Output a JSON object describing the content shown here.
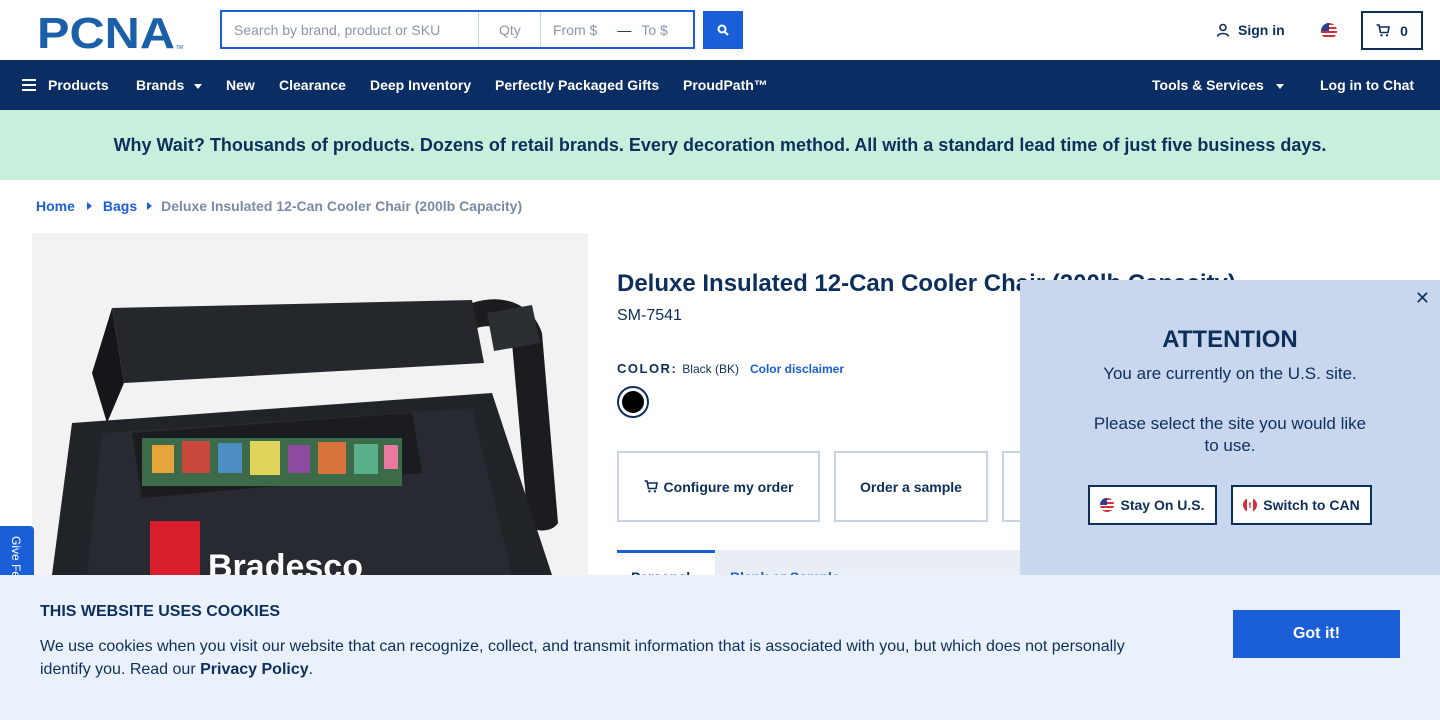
{
  "brand": {
    "name": "PCNA",
    "trademark": "TM"
  },
  "search": {
    "keyword_placeholder": "Search by brand, product or SKU",
    "qty_placeholder": "Qty",
    "price_from_placeholder": "From $",
    "price_to_placeholder": "To $",
    "dash": "—"
  },
  "account": {
    "sign_in_label": "Sign in"
  },
  "cart": {
    "count": "0"
  },
  "nav": {
    "products": "Products",
    "brands": "Brands",
    "new": "New",
    "clearance": "Clearance",
    "deep_inventory": "Deep Inventory",
    "perfectly_packaged": "Perfectly Packaged Gifts",
    "proudpath": "ProudPath™",
    "tools": "Tools & Services",
    "chat": "Log in to Chat"
  },
  "promo": {
    "text": "Why Wait? Thousands of products. Dozens of retail brands. Every decoration method. All with a standard lead time of just five business days."
  },
  "breadcrumb": {
    "items": [
      "Home",
      "Bags"
    ],
    "current": "Deluxe Insulated 12-Can Cooler Chair (200lb Capacity)"
  },
  "product": {
    "title": "Deluxe Insulated 12-Can Cooler Chair (200lb Capacity)",
    "sku": "SM-7541",
    "color_label": "COLOR:",
    "color_value": "Black (BK)",
    "color_disclaimer": "Color disclaimer",
    "swatch_color": "#000000",
    "image_print": "Bradesco"
  },
  "actions": {
    "configure": "Configure my order",
    "sample": "Order a sample"
  },
  "tabs": {
    "active": "Personal",
    "other": "Blank or Sample"
  },
  "feedback": {
    "label": "Give Feedback"
  },
  "attention": {
    "close": "✕",
    "title": "ATTENTION",
    "line1": "You are currently on the U.S. site.",
    "line2": "Please select the site you would like to use.",
    "stay_us": "Stay On U.S.",
    "switch_can": "Switch to CAN"
  },
  "cookie": {
    "title": "THIS WEBSITE USES COOKIES",
    "body": "We use cookies when you visit our website that can recognize, collect, and transmit information that is associated with you, but which does not personally identify you. Read our",
    "policy_link": "Privacy Policy",
    "period": ".",
    "accept": "Got it!"
  },
  "colors": {
    "navy": "#0a2d63",
    "accent_blue": "#1b5fd8",
    "promo_green": "#c6f0dc",
    "attention_bg": "#c9d7ee",
    "cookie_bg": "#ebf1fb"
  }
}
